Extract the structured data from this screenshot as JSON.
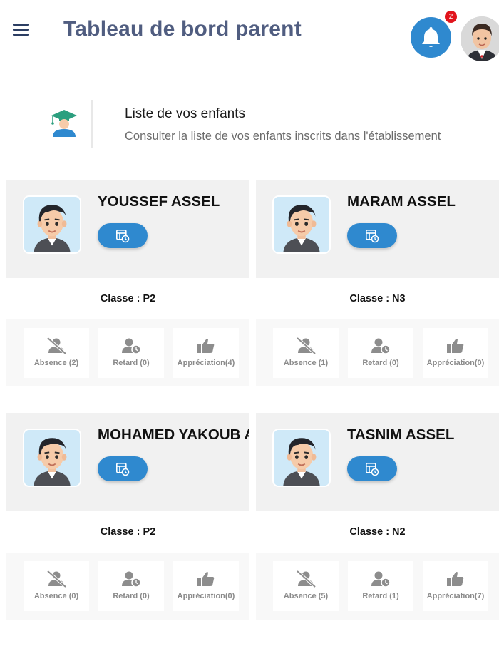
{
  "header": {
    "title": "Tableau de bord parent",
    "notification_count": "2",
    "menu_icon": "hamburger-icon",
    "bell_icon": "bell-icon",
    "accent_color": "#2f89cf",
    "badge_color": "#e1141c"
  },
  "intro": {
    "title": "Liste de vos enfants",
    "subtitle": "Consulter la liste de vos enfants inscrits dans l'établissement",
    "icon": "graduate-student-icon"
  },
  "children": [
    {
      "name": "YOUSSEF ASSEL",
      "classe": "Classe : P2",
      "absence": "Absence (2)",
      "retard": "Retard (0)",
      "appreciation": "Appréciation(4)"
    },
    {
      "name": "MARAM ASSEL",
      "classe": "Classe : N3",
      "absence": "Absence (1)",
      "retard": "Retard (0)",
      "appreciation": "Appréciation(0)"
    },
    {
      "name": "MOHAMED YAKOUB ASSEL",
      "classe": "Classe : P2",
      "absence": "Absence (0)",
      "retard": "Retard (0)",
      "appreciation": "Appréciation(0)"
    },
    {
      "name": "TASNIM ASSEL",
      "classe": "Classe : N2",
      "absence": "Absence (5)",
      "retard": "Retard (1)",
      "appreciation": "Appréciation(7)"
    }
  ]
}
